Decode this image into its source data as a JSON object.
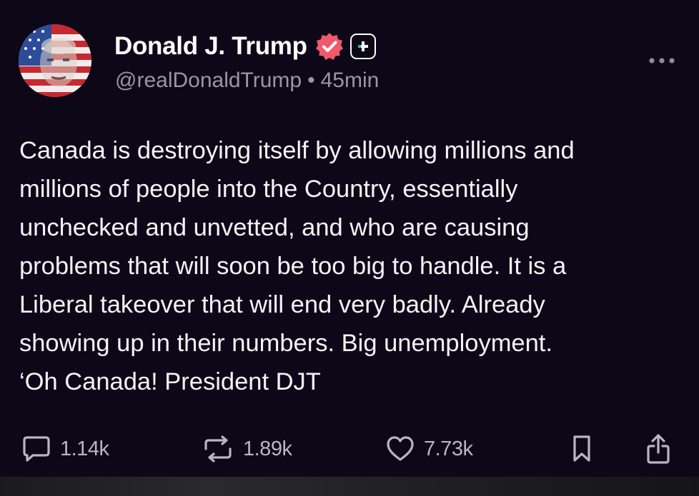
{
  "post": {
    "author": {
      "display_name": "Donald J. Trump",
      "handle": "@realDonaldTrump",
      "separator": "•",
      "time_ago": "45min",
      "verified": true
    },
    "body_lines": [
      "Canada is destroying itself by allowing millions and",
      "millions of people into the Country, essentially",
      "unchecked and unvetted, and who are causing",
      "problems that will soon be too big to handle. It is a",
      "Liberal takeover that will end very badly. Already",
      "showing up in their numbers. Big unemployment.",
      "‘Oh Canada! President DJT"
    ],
    "actions": {
      "replies": "1.14k",
      "reposts": "1.89k",
      "likes": "7.73k"
    }
  },
  "icons": {
    "more": "more-horizontal-icon",
    "verified": "verified-badge-icon",
    "plus": "plus-icon",
    "reply": "reply-bubble-icon",
    "repost": "repost-icon",
    "like": "heart-icon",
    "bookmark": "bookmark-icon",
    "share": "share-icon"
  },
  "colors": {
    "background": "#0d0818",
    "verified_badge": "#f0596b",
    "secondary_text": "#9a96a6"
  }
}
